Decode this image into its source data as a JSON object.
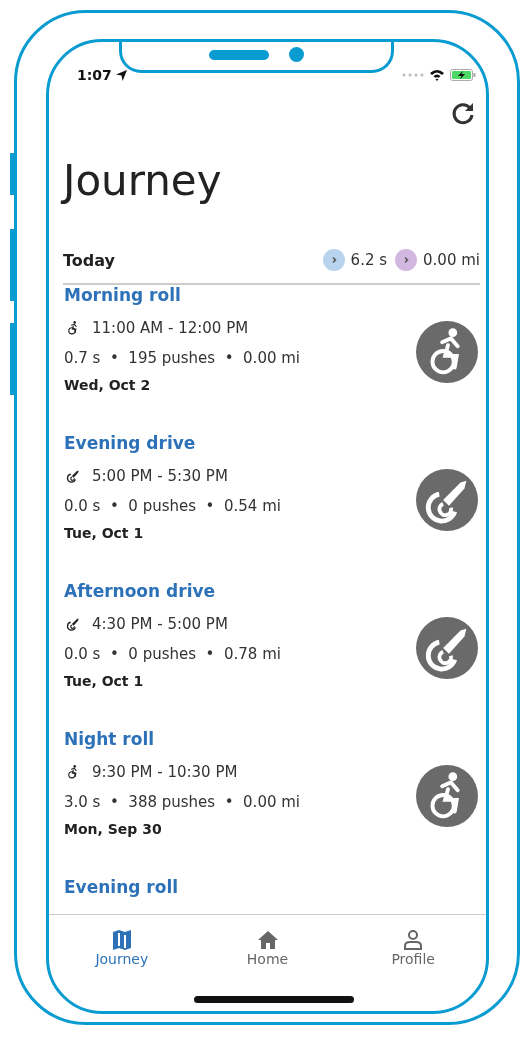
{
  "status_bar": {
    "time": "1:07"
  },
  "page": {
    "title": "Journey"
  },
  "summary": {
    "label": "Today",
    "stats": [
      {
        "value": "6.2 s",
        "color": "#b7d3ee"
      },
      {
        "value": "0.00 mi",
        "color": "#d2b8e0"
      }
    ]
  },
  "activities": [
    {
      "kind": "roll",
      "title": "Morning roll",
      "time": "11:00 AM - 12:00 PM",
      "stats": "0.7 s  •  195 pushes  •  0.00 mi",
      "date": "Wed, Oct 2"
    },
    {
      "kind": "drive",
      "title": "Evening drive",
      "time": "5:00 PM - 5:30 PM",
      "stats": "0.0 s  •  0 pushes  •  0.54 mi",
      "date": "Tue, Oct 1"
    },
    {
      "kind": "drive",
      "title": "Afternoon drive",
      "time": "4:30 PM - 5:00 PM",
      "stats": "0.0 s  •  0 pushes  •  0.78 mi",
      "date": "Tue, Oct 1"
    },
    {
      "kind": "roll",
      "title": "Night roll",
      "time": "9:30 PM - 10:30 PM",
      "stats": "3.0 s  •  388 pushes  •  0.00 mi",
      "date": "Mon, Sep 30"
    },
    {
      "title": "Evening roll"
    }
  ],
  "tabs": [
    {
      "label": "Journey",
      "selected": true
    },
    {
      "label": "Home",
      "selected": false
    },
    {
      "label": "Profile",
      "selected": false
    }
  ]
}
